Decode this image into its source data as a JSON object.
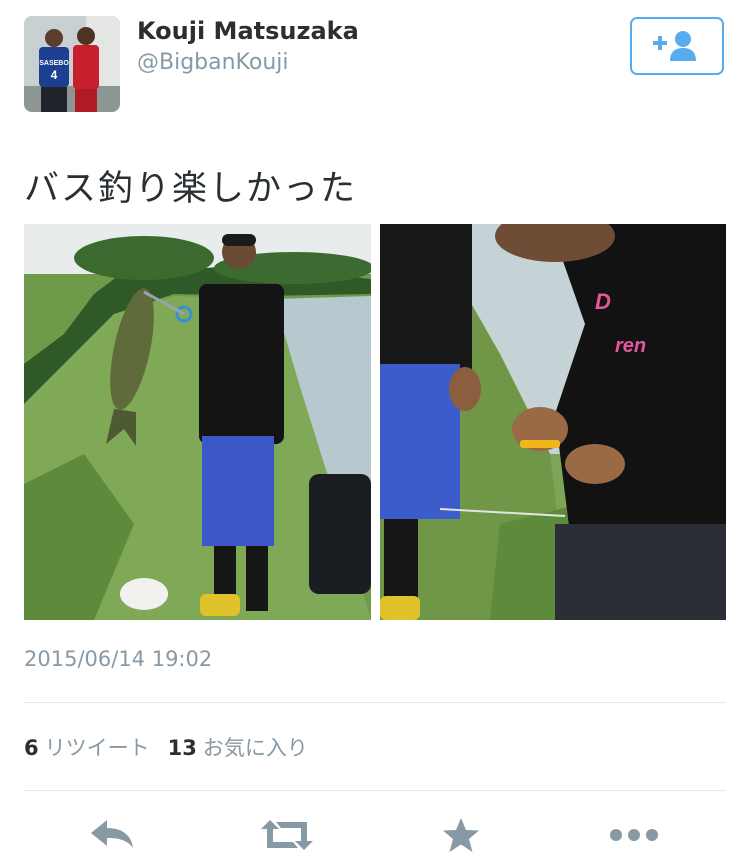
{
  "user": {
    "display_name": "Kouji Matsuzaka",
    "username": "@BigbanKouji",
    "avatar_jersey_text": "SASEBO",
    "avatar_jersey_number": "4"
  },
  "follow_button": {
    "icon": "follow-user-icon"
  },
  "tweet": {
    "text": "バス釣り楽しかった",
    "timestamp": "2015/06/14 19:02"
  },
  "photos": [
    {
      "name": "photo-fishing-holding-bass"
    },
    {
      "name": "photo-fishing-unhooking",
      "shirt_text_1": "D",
      "shirt_text_2": "ren"
    }
  ],
  "stats": {
    "retweets_count": "6",
    "retweets_label": "リツイート",
    "favorites_count": "13",
    "favorites_label": "お気に入り"
  },
  "actions": {
    "reply": "reply-icon",
    "retweet": "retweet-icon",
    "favorite": "star-icon",
    "more": "more-icon"
  },
  "colors": {
    "accent": "#55acee",
    "secondary_text": "#8899a6",
    "primary_text": "#292f33",
    "divider": "#e1e8ed"
  }
}
